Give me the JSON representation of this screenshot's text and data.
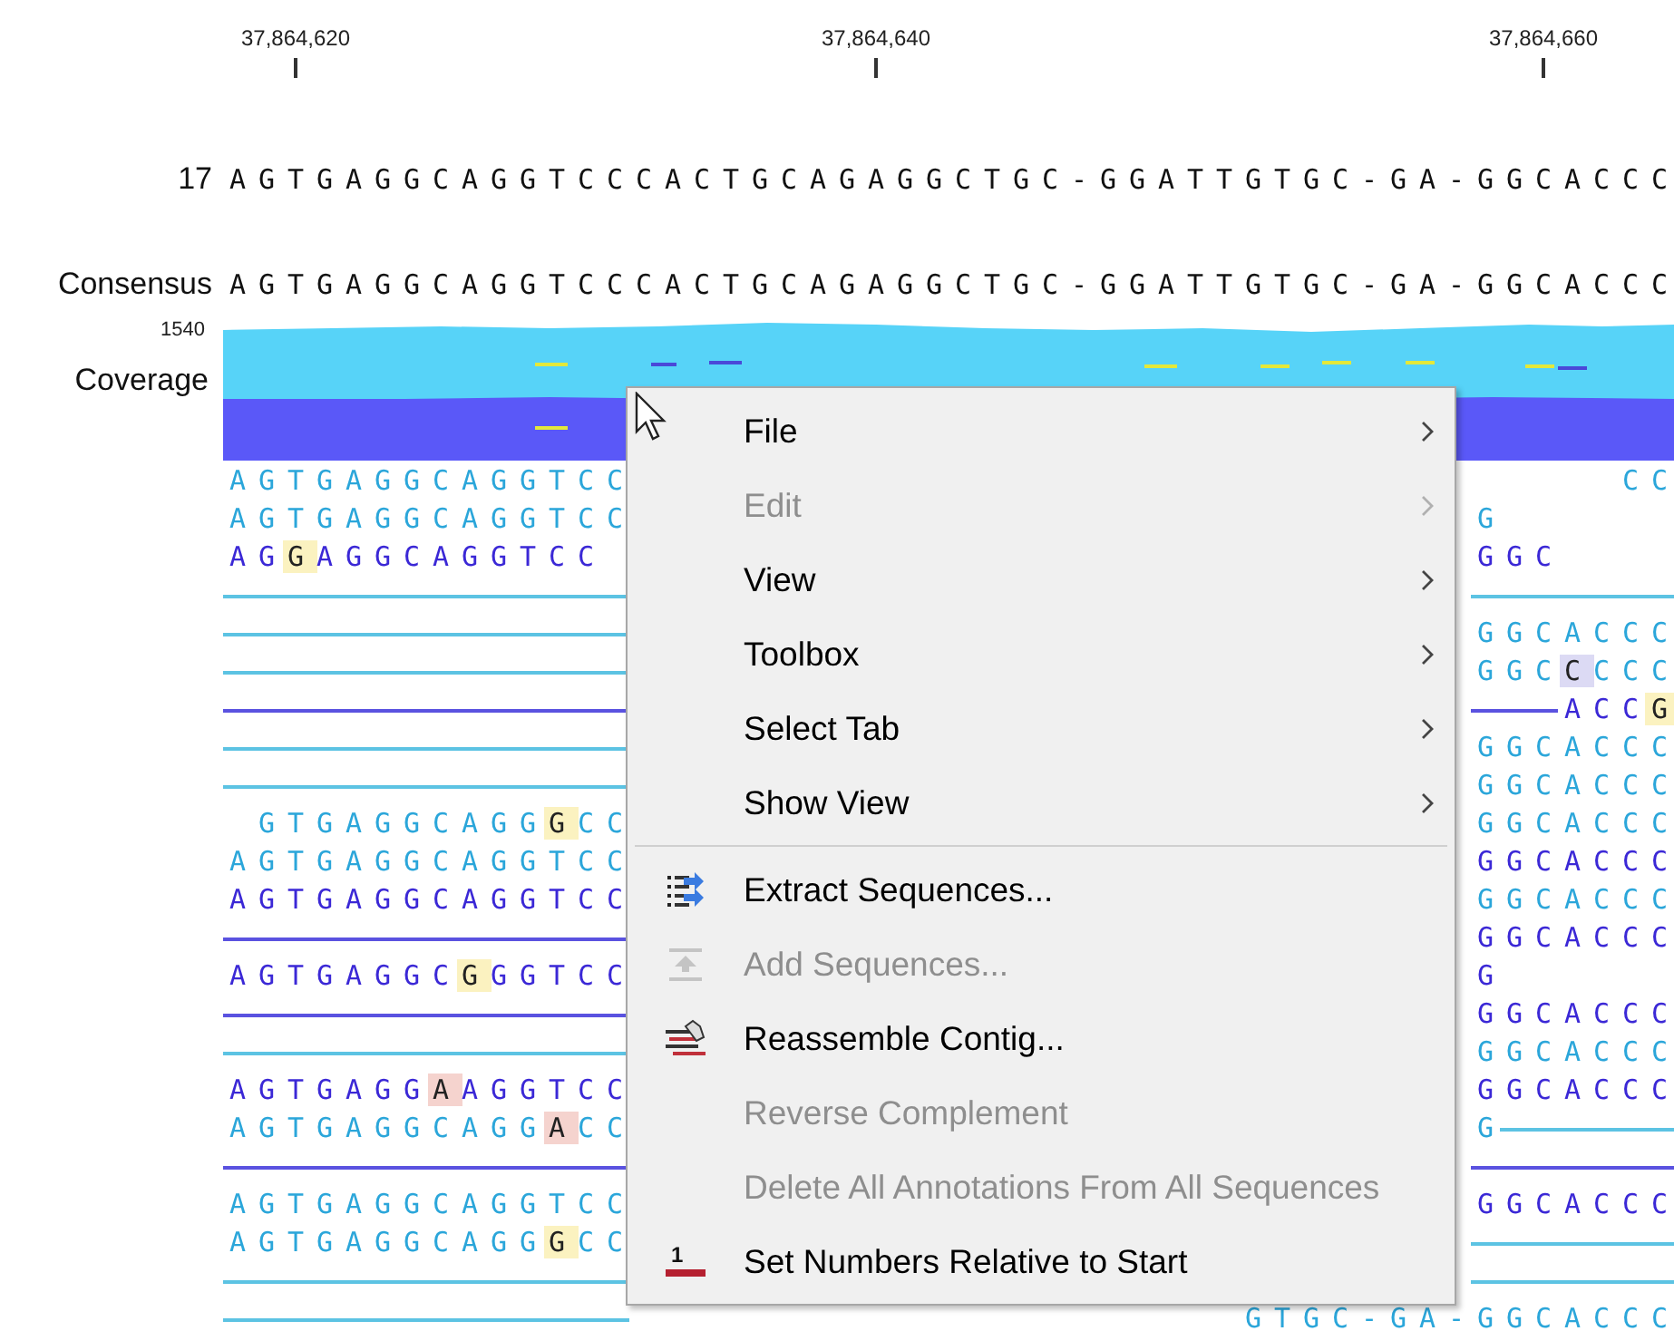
{
  "ruler": {
    "ticks": [
      "37,864,620",
      "37,864,640",
      "37,864,660"
    ]
  },
  "reference": {
    "name": "17",
    "sequence": "AGTGAGGCAGGTCCCACTGCAGAGGCTGC-GGATTGTGC-GA-GGCACCC"
  },
  "consensus": {
    "name": "Consensus",
    "sequence": "AGTGAGGCAGGTCCCACTGCAGAGGCTGC-GGATTGTGC-GA-GGCACCC"
  },
  "coverage": {
    "max_label": "1540",
    "name": "Coverage"
  },
  "reads": [
    {
      "left": [
        {
          "kind": "seq",
          "text": "AGTGAGGCAGGTCC",
          "color": "#2ba6da"
        }
      ],
      "right": [
        {
          "kind": "space"
        },
        {
          "kind": "seq",
          "text": "CC",
          "color": "#2ba6da"
        }
      ]
    },
    {
      "left": [
        {
          "kind": "seq",
          "text": "AGTGAGGCAGGTCC",
          "color": "#2ba6da"
        }
      ],
      "right": [
        {
          "kind": "seq",
          "text": "G",
          "color": "#2ba6da"
        }
      ]
    },
    {
      "left": [
        {
          "kind": "seq",
          "color": "#3b28d6",
          "parts": [
            {
              "text": "AG"
            },
            {
              "text": "G",
              "color": "#fbf2c0"
            },
            {
              "text": "AGGCAGGTCC"
            }
          ]
        }
      ],
      "right": [
        {
          "kind": "seq",
          "text": "GGC",
          "color": "#3b28d6"
        }
      ]
    },
    {
      "left": [
        {
          "kind": "line",
          "color": "#5cc3e3"
        }
      ],
      "right": [
        {
          "kind": "line",
          "color": "#5cc3e3"
        }
      ]
    },
    {
      "left": [
        {
          "kind": "line",
          "color": "#5cc3e3"
        }
      ],
      "right": [
        {
          "kind": "seq",
          "text": "GGCACCC",
          "color": "#2ba6da"
        }
      ]
    },
    {
      "left": [
        {
          "kind": "line",
          "color": "#5cc3e3"
        }
      ],
      "right": [
        {
          "kind": "seq",
          "color": "#2ba6da",
          "parts": [
            {
              "text": "GGC"
            },
            {
              "text": "C",
              "color": "#dcdaf4"
            },
            {
              "text": "CCC"
            }
          ]
        }
      ]
    },
    {
      "left": [
        {
          "kind": "line",
          "color": "#5a52e0"
        }
      ],
      "right": [
        {
          "kind": "line",
          "color": "#5a52e0"
        },
        {
          "kind": "seq",
          "color": "#3b28d6",
          "parts": [
            {
              "text": "ACC"
            },
            {
              "text": "G",
              "color": "#fbf2c0"
            }
          ]
        }
      ]
    },
    {
      "left": [
        {
          "kind": "line",
          "color": "#5cc3e3"
        }
      ],
      "right": [
        {
          "kind": "seq",
          "text": "GGCACCC",
          "color": "#2ba6da"
        }
      ]
    },
    {
      "left": [
        {
          "kind": "line",
          "color": "#5cc3e3"
        }
      ],
      "right": [
        {
          "kind": "seq",
          "text": "GGCACCC",
          "color": "#2ba6da"
        }
      ]
    },
    {
      "left": [
        {
          "kind": "pad"
        },
        {
          "kind": "seq",
          "color": "#2ba6da",
          "parts": [
            {
              "text": "GTGAGGCAGG"
            },
            {
              "text": "G",
              "color": "#fbf2c0"
            },
            {
              "text": "CC"
            }
          ]
        }
      ],
      "right": [
        {
          "kind": "seq",
          "text": "GGCACCC",
          "color": "#2ba6da"
        }
      ]
    },
    {
      "left": [
        {
          "kind": "seq",
          "text": "AGTGAGGCAGGTCC",
          "color": "#2ba6da"
        }
      ],
      "right": [
        {
          "kind": "seq",
          "text": "GGCACCC",
          "color": "#3b28d6"
        }
      ]
    },
    {
      "left": [
        {
          "kind": "seq",
          "text": "AGTGAGGCAGGTCC",
          "color": "#3b28d6"
        }
      ],
      "right": [
        {
          "kind": "seq",
          "text": "GGCACCC",
          "color": "#2ba6da"
        }
      ]
    },
    {
      "left": [
        {
          "kind": "line",
          "color": "#5a52e0"
        }
      ],
      "right": [
        {
          "kind": "seq",
          "text": "GGCACCC",
          "color": "#3b28d6"
        }
      ]
    },
    {
      "left": [
        {
          "kind": "seq",
          "color": "#3b28d6",
          "parts": [
            {
              "text": "AGTGAGGC"
            },
            {
              "text": "G",
              "color": "#fbf2c0"
            },
            {
              "text": "GGTCC"
            }
          ]
        }
      ],
      "right": [
        {
          "kind": "seq",
          "text": "G",
          "color": "#3b28d6"
        }
      ]
    },
    {
      "left": [
        {
          "kind": "line",
          "color": "#5a52e0"
        }
      ],
      "right": [
        {
          "kind": "seq",
          "text": "GGCACCC",
          "color": "#3b28d6"
        }
      ]
    },
    {
      "left": [
        {
          "kind": "line",
          "color": "#5cc3e3"
        }
      ],
      "right": [
        {
          "kind": "seq",
          "text": "GGCACCC",
          "color": "#2ba6da"
        }
      ]
    },
    {
      "left": [
        {
          "kind": "seq",
          "color": "#3b28d6",
          "parts": [
            {
              "text": "AGTGAGG"
            },
            {
              "text": "A",
              "color": "#f5d3ce"
            },
            {
              "text": "AGGTCC"
            }
          ]
        }
      ],
      "right": [
        {
          "kind": "seq",
          "text": "GGCACCC",
          "color": "#3b28d6"
        }
      ]
    },
    {
      "left": [
        {
          "kind": "seq",
          "color": "#2ba6da",
          "parts": [
            {
              "text": "AGTGAGGCAGG"
            },
            {
              "text": "A",
              "color": "#f5d3ce"
            },
            {
              "text": "CC"
            }
          ]
        }
      ],
      "right": [
        {
          "kind": "seq",
          "text": "G",
          "color": "#2ba6da"
        },
        {
          "kind": "line",
          "color": "#5cc3e3"
        }
      ]
    },
    {
      "left": [
        {
          "kind": "line",
          "color": "#5a52e0"
        }
      ],
      "right": [
        {
          "kind": "line",
          "color": "#5a52e0"
        }
      ]
    },
    {
      "left": [
        {
          "kind": "seq",
          "text": "AGTGAGGCAGGTCC",
          "color": "#2ba6da"
        }
      ],
      "right": [
        {
          "kind": "seq",
          "text": "GGCACCC",
          "color": "#3b28d6"
        }
      ]
    },
    {
      "left": [
        {
          "kind": "seq",
          "color": "#2ba6da",
          "parts": [
            {
              "text": "AGTGAGGCAGG"
            },
            {
              "text": "G",
              "color": "#fbf2c0"
            },
            {
              "text": "CC"
            }
          ]
        }
      ],
      "right": [
        {
          "kind": "line",
          "color": "#5cc3e3"
        }
      ]
    },
    {
      "left": [
        {
          "kind": "line",
          "color": "#5cc3e3"
        }
      ],
      "right": [
        {
          "kind": "line",
          "color": "#5cc3e3"
        }
      ]
    },
    {
      "left": [
        {
          "kind": "line",
          "color": "#5cc3e3"
        }
      ],
      "middle": [
        {
          "kind": "space"
        },
        {
          "kind": "seq",
          "text": "GTGC-GA-",
          "color": "#2ba6da"
        }
      ],
      "right": [
        {
          "kind": "seq",
          "text": "GGCACCC",
          "color": "#2ba6da"
        }
      ]
    }
  ],
  "context_menu": {
    "items": [
      {
        "kind": "item",
        "label": "File",
        "disabled": false,
        "submenu": true
      },
      {
        "kind": "item",
        "label": "Edit",
        "disabled": true,
        "submenu": true
      },
      {
        "kind": "item",
        "label": "View",
        "disabled": false,
        "submenu": true
      },
      {
        "kind": "item",
        "label": "Toolbox",
        "disabled": false,
        "submenu": true
      },
      {
        "kind": "item",
        "label": "Select Tab",
        "disabled": false,
        "submenu": true
      },
      {
        "kind": "item",
        "label": "Show View",
        "disabled": false,
        "submenu": true
      },
      {
        "kind": "separator"
      },
      {
        "kind": "item",
        "label": "Extract Sequences...",
        "disabled": false,
        "submenu": false
      },
      {
        "kind": "item",
        "label": "Add Sequences...",
        "disabled": true,
        "submenu": false
      },
      {
        "kind": "item",
        "label": "Reassemble Contig...",
        "disabled": false,
        "submenu": false
      },
      {
        "kind": "item",
        "label": "Reverse Complement",
        "disabled": true,
        "submenu": false
      },
      {
        "kind": "item",
        "label": "Delete All Annotations From All Sequences",
        "disabled": true,
        "submenu": false
      },
      {
        "kind": "item",
        "label": "Set Numbers Relative to Start",
        "disabled": false,
        "submenu": false,
        "icon_text": "1"
      }
    ]
  }
}
